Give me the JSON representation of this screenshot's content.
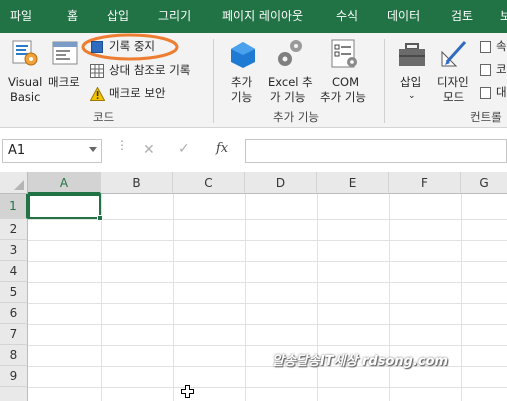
{
  "menu": {
    "tabs": [
      {
        "label": "파일"
      },
      {
        "label": "홈"
      },
      {
        "label": "삽입"
      },
      {
        "label": "그리기"
      },
      {
        "label": "페이지 레이아웃"
      },
      {
        "label": "수식"
      },
      {
        "label": "데이터"
      },
      {
        "label": "검토"
      },
      {
        "label": "보"
      }
    ],
    "bg_color": "#217346"
  },
  "ribbon": {
    "code_group": {
      "visual_basic_line1": "Visual",
      "visual_basic_line2": "Basic",
      "macro_label": "매크로",
      "record_stop_label": "기록 중지",
      "relative_ref_label": "상대 참조로 기록",
      "macro_security_label": "매크로 보안",
      "group_label": "코드"
    },
    "addins_group": {
      "addins_line1": "추가",
      "addins_line2": "기능",
      "excel_addins_line1": "Excel 추",
      "excel_addins_line2": "가 기능",
      "com_addins_line1": "COM",
      "com_addins_line2": "추가 기능",
      "group_label": "추가 기능"
    },
    "controls_group": {
      "insert_label": "삽입",
      "design_mode_line1": "디자인",
      "design_mode_line2": "모드",
      "properties_partial": "속",
      "view_code_partial": "코",
      "dialog_partial": "대",
      "group_label": "컨트롤"
    },
    "highlight_color": "#ed7d31"
  },
  "formula_bar": {
    "name_box_value": "A1",
    "cancel_icon": "x-icon",
    "enter_icon": "check-icon",
    "fx_label": "fx",
    "formula_value": ""
  },
  "grid": {
    "columns": [
      "A",
      "B",
      "C",
      "D",
      "E",
      "F",
      "G"
    ],
    "rows": [
      "1",
      "2",
      "3",
      "4",
      "5",
      "6",
      "7",
      "8",
      "9"
    ],
    "selected_cell": "A1",
    "accent_color": "#217346"
  },
  "watermark": "알송달송IT세상 rdsong.com"
}
